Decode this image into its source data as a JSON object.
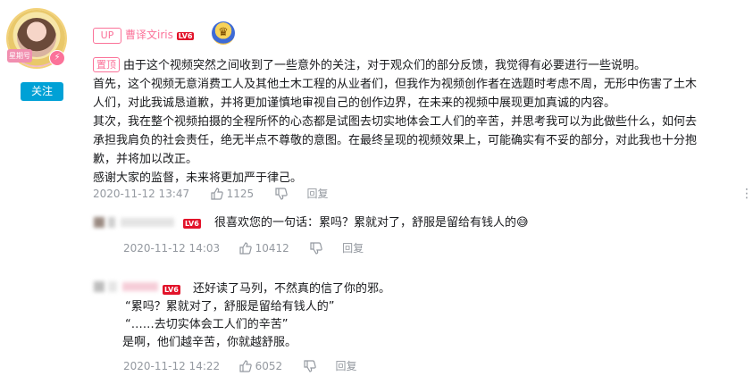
{
  "avatar": {
    "tag": "星期号"
  },
  "follow_label": "关注",
  "top_comment": {
    "up_badge": "UP",
    "username": "曹译文iris",
    "level": "LV6",
    "pin_label": "置顶",
    "lines": [
      "由于这个视频突然之间收到了一些意外的关注，对于观众们的部分反馈，我觉得有必要进行一些说明。",
      "首先，这个视频无意消费工人及其他土木工程的从业者们，但我作为视频创作者在选题时考虑不周，无形中伤害了土木",
      "人们，对此我诚恳道歉，并将更加谨慎地审视自己的创作边界，在未来的视频中展现更加真诚的内容。",
      "其次，我在整个视频拍摄的全程所怀的心态都是试图去切实地体会工人们的辛苦，并思考我可以为此做些什么，如何去",
      "承担我肩负的社会责任，绝无半点不尊敬的意图。在最终呈现的视频效果上，可能确实有不妥的部分，对此我也十分抱",
      "歉，并将加以改正。",
      "感谢大家的监督，未来将更加严于律己。"
    ],
    "time": "2020-11-12 13:47",
    "likes": "1125",
    "reply_label": "回复"
  },
  "replies": [
    {
      "level": "LV6",
      "text": "很喜欢您的一句话：累吗？累就对了，舒服是留给有钱人的",
      "emoji": "😅",
      "time": "2020-11-12 14:03",
      "likes": "10412",
      "reply_label": "回复"
    },
    {
      "level": "LV6",
      "lines": [
        "还好读了马列，不然真的信了你的邪。",
        "“累吗？累就对了，舒服是留给有钱人的”",
        "“……去切实体会工人们的辛苦”",
        "是啊，他们越辛苦，你就越舒服。"
      ],
      "time": "2020-11-12 14:22",
      "likes": "6052",
      "reply_label": "回复"
    }
  ],
  "colors": {
    "accent": "#00a1d6",
    "pink": "#fb7299",
    "meta": "#9499a0",
    "level": "#e2132a"
  }
}
